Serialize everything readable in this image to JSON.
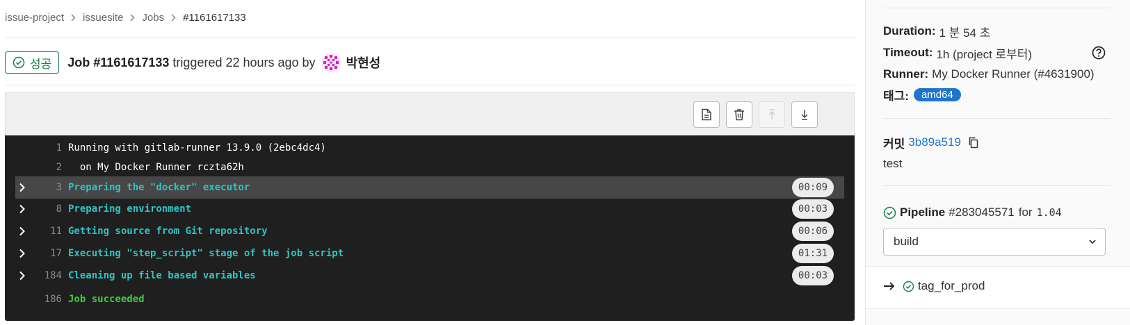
{
  "breadcrumb": [
    "issue-project",
    "issuesite",
    "Jobs",
    "#1161617133"
  ],
  "job": {
    "status": "성공",
    "title": "Job #1161617133",
    "triggered": "triggered 22 hours ago by",
    "user": "박현성"
  },
  "log": {
    "lines": [
      {
        "num": "1",
        "text": "Running with gitlab-runner 13.9.0 (2ebc4dc4)",
        "style": "plain"
      },
      {
        "num": "2",
        "text": "  on My Docker Runner rczta62h",
        "style": "plain"
      },
      {
        "num": "3",
        "text": "Preparing the \"docker\" executor",
        "style": "section",
        "duration": "00:09"
      },
      {
        "num": "8",
        "text": "Preparing environment",
        "style": "section",
        "duration": "00:03"
      },
      {
        "num": "11",
        "text": "Getting source from Git repository",
        "style": "section",
        "duration": "00:06"
      },
      {
        "num": "17",
        "text": "Executing \"step_script\" stage of the job script",
        "style": "section",
        "duration": "01:31"
      },
      {
        "num": "184",
        "text": "Cleaning up file based variables",
        "style": "section",
        "duration": "00:03"
      },
      {
        "num": "186",
        "text": "Job succeeded",
        "style": "success"
      }
    ]
  },
  "sidebar": {
    "duration_key": "Duration:",
    "duration_val": "1 분 54 초",
    "timeout_key": "Timeout:",
    "timeout_val": "1h (project 로부터)",
    "runner_key": "Runner:",
    "runner_val": "My Docker Runner (#4631900)",
    "tags_key": "태그:",
    "tag": "amd64",
    "commit_key": "커밋",
    "commit_sha": "3b89a519",
    "commit_msg": "test",
    "pipeline_key": "Pipeline",
    "pipeline_id": "#283045571",
    "pipeline_for": "for",
    "pipeline_ref": "1.04",
    "stage_select": "build",
    "job_name": "tag_for_prod"
  },
  "colors": {
    "success": "#108548",
    "link": "#1f75cb",
    "log_bg": "#1f1f1f",
    "log_cyan": "#2ec4c4",
    "log_green": "#3cd03c"
  }
}
